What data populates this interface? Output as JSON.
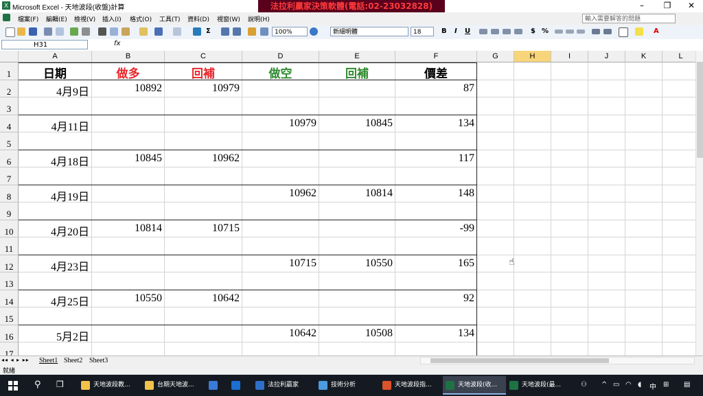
{
  "window": {
    "title": "Microsoft Excel - 天地波段(收盤)計算",
    "banner": "法拉利贏家決策軟體(電話:02-23032828)",
    "min_label": "–",
    "max_label": "❐",
    "close_label": "✕"
  },
  "menu": {
    "items": [
      "檔案(F)",
      "編輯(E)",
      "檢視(V)",
      "插入(I)",
      "格式(O)",
      "工具(T)",
      "資料(D)",
      "視窗(W)",
      "說明(H)"
    ],
    "help_placeholder": "輸入需要解答的問題"
  },
  "toolbar": {
    "zoom": "100%",
    "font_name": "新細明體",
    "font_size": "18",
    "bold": "B",
    "italic": "I",
    "underline": "U",
    "currency": "$",
    "percent": "%",
    "font_color_label": "A"
  },
  "formula_bar": {
    "name_box": "H31",
    "fx": "fx",
    "value": ""
  },
  "columns": [
    "A",
    "B",
    "C",
    "D",
    "E",
    "F",
    "G",
    "H",
    "I",
    "J",
    "K",
    "L"
  ],
  "active_column": "H",
  "header_row": {
    "A": "日期",
    "B": "做多",
    "C": "回補",
    "D": "做空",
    "E": "回補",
    "F": "價差"
  },
  "header_colors": {
    "A": "#000000",
    "B": "#e8262b",
    "C": "#e8262b",
    "D": "#2e8b2e",
    "E": "#2e8b2e",
    "F": "#000000"
  },
  "rows": [
    {
      "n": "1"
    },
    {
      "n": "2",
      "A": "4月9日",
      "B": "10892",
      "C": "10979",
      "F": "87"
    },
    {
      "n": "3"
    },
    {
      "n": "4",
      "A": "4月11日",
      "D": "10979",
      "E": "10845",
      "F": "134"
    },
    {
      "n": "5"
    },
    {
      "n": "6",
      "A": "4月18日",
      "B": "10845",
      "C": "10962",
      "F": "117"
    },
    {
      "n": "7"
    },
    {
      "n": "8",
      "A": "4月19日",
      "D": "10962",
      "E": "10814",
      "F": "148"
    },
    {
      "n": "9"
    },
    {
      "n": "10",
      "A": "4月20日",
      "B": "10814",
      "C": "10715",
      "F": "-99"
    },
    {
      "n": "11"
    },
    {
      "n": "12",
      "A": "4月23日",
      "D": "10715",
      "E": "10550",
      "F": "165"
    },
    {
      "n": "13"
    },
    {
      "n": "14",
      "A": "4月25日",
      "B": "10550",
      "C": "10642",
      "F": "92"
    },
    {
      "n": "15"
    },
    {
      "n": "16",
      "A": "5月2日",
      "D": "10642",
      "E": "10508",
      "F": "134"
    },
    {
      "n": "17"
    }
  ],
  "sheet_tabs": [
    "Sheet1",
    "Sheet2",
    "Sheet3"
  ],
  "active_sheet": "Sheet1",
  "status": "就緒",
  "taskbar": {
    "apps": [
      {
        "label": "天地波段教...",
        "color": "#f2c24b"
      },
      {
        "label": "台期天地波...",
        "color": "#f2c24b"
      },
      {
        "label": "",
        "color": "#3b7bd8"
      },
      {
        "label": "",
        "color": "#1b6fd1"
      },
      {
        "label": "法拉利贏家",
        "color": "#2f6fc8"
      },
      {
        "label": "技術分析",
        "color": "#4a9be0"
      },
      {
        "label": "天地波段指...",
        "color": "#d9532b"
      },
      {
        "label": "天地波段(收...",
        "color": "#1f7244"
      },
      {
        "label": "天地波段(最...",
        "color": "#1f7244"
      }
    ],
    "ime": "中",
    "ime2": "⊞"
  }
}
